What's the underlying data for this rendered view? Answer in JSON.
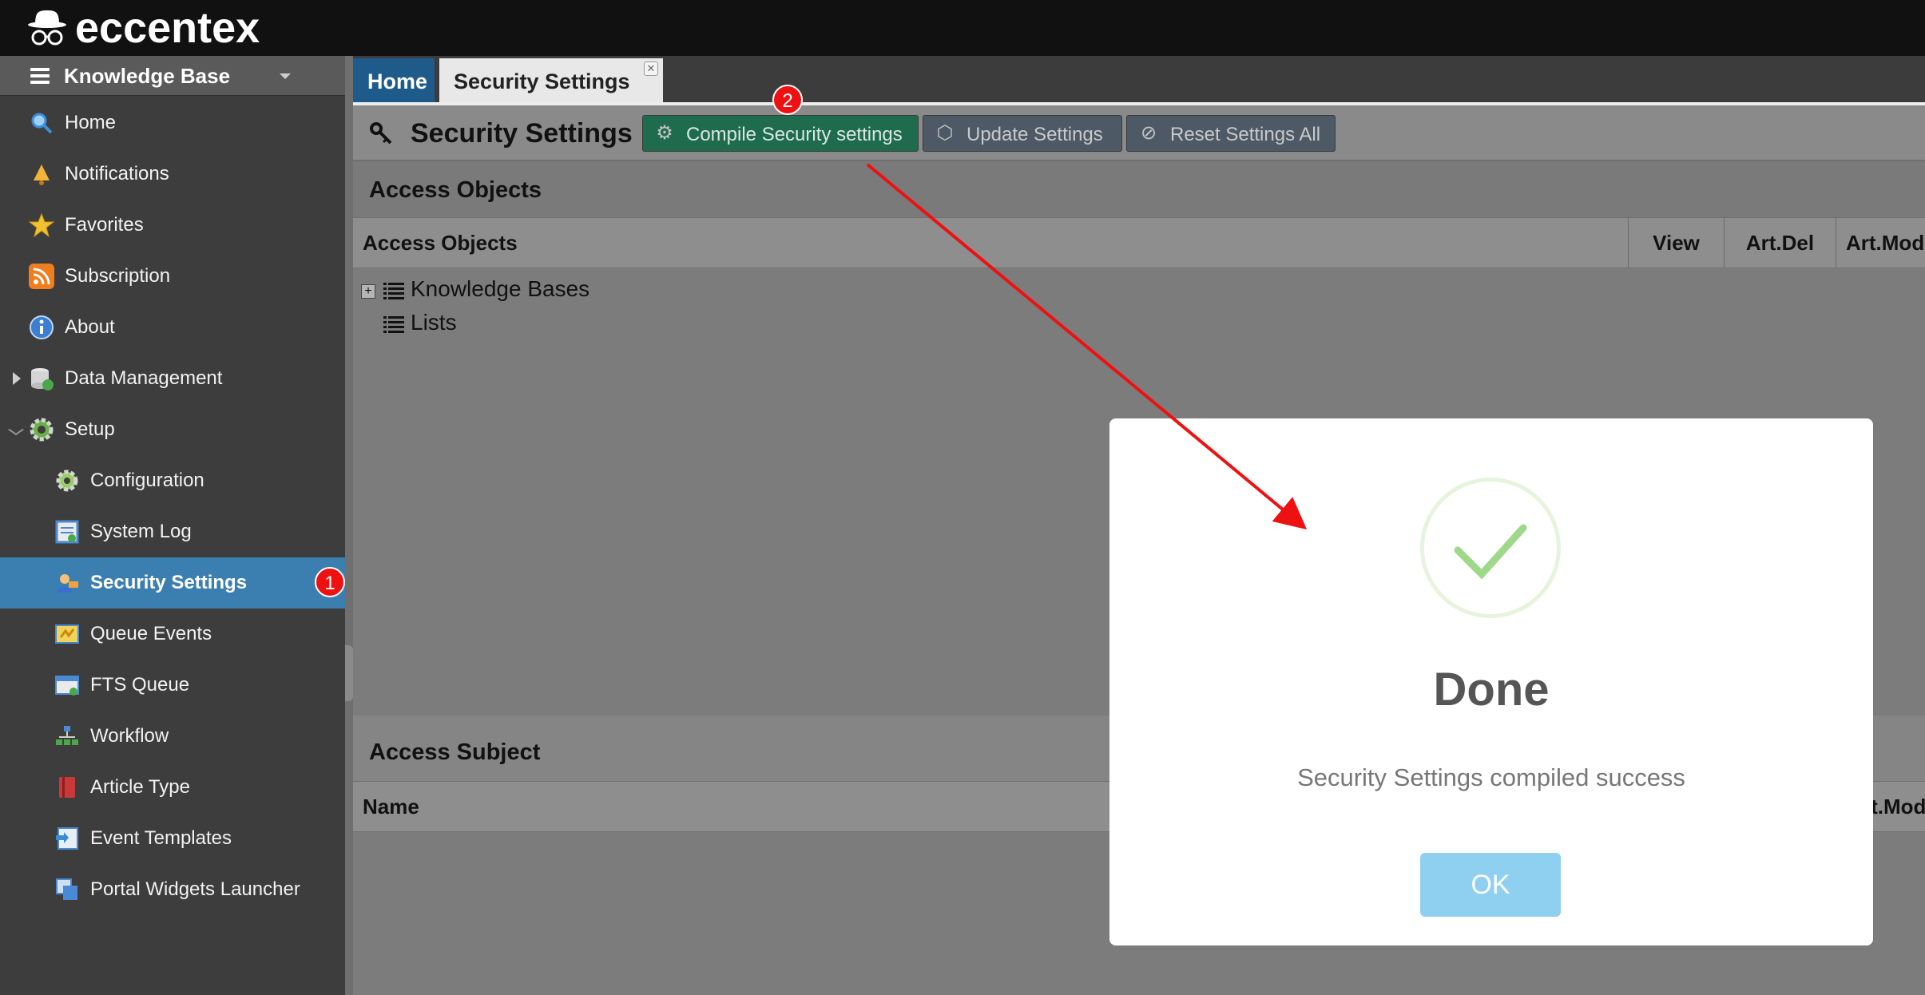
{
  "brand": {
    "name": "eccentex"
  },
  "sidebar": {
    "header": "Knowledge Base",
    "items": [
      {
        "label": "Home",
        "icon": "search-icon",
        "color": "#3c8fd9"
      },
      {
        "label": "Notifications",
        "icon": "bell-icon",
        "color": "#e0a030"
      },
      {
        "label": "Favorites",
        "icon": "star-icon",
        "color": "#f2c12e"
      },
      {
        "label": "Subscription",
        "icon": "rss-icon",
        "color": "#f07d1e"
      },
      {
        "label": "About",
        "icon": "info-icon",
        "color": "#3c7fd0"
      },
      {
        "label": "Data Management",
        "icon": "database-icon",
        "color": "#4aa84a"
      },
      {
        "label": "Setup",
        "icon": "gears-icon",
        "color": "#6bb04a"
      },
      {
        "label": "Configuration",
        "icon": "gear-icon",
        "color": "#6bb04a"
      },
      {
        "label": "System Log",
        "icon": "log-icon",
        "color": "#4a8ad4"
      },
      {
        "label": "Security Settings",
        "icon": "security-user-icon",
        "color": "#e8a038"
      },
      {
        "label": "Queue Events",
        "icon": "queue-icon",
        "color": "#e8c040"
      },
      {
        "label": "FTS Queue",
        "icon": "fts-icon",
        "color": "#4a8ad4"
      },
      {
        "label": "Workflow",
        "icon": "workflow-icon",
        "color": "#4aa84a"
      },
      {
        "label": "Article Type",
        "icon": "book-icon",
        "color": "#c83a3a"
      },
      {
        "label": "Event Templates",
        "icon": "template-icon",
        "color": "#4a8ad4"
      },
      {
        "label": "Portal Widgets Launcher",
        "icon": "widgets-icon",
        "color": "#4a8ad4"
      }
    ],
    "badge": "1"
  },
  "tabs": [
    {
      "label": "Home"
    },
    {
      "label": "Security Settings",
      "close": "✕"
    }
  ],
  "toolbar": {
    "title": "Security Settings",
    "badge": "2",
    "compile_label": "Compile Security settings",
    "update_label": "Update Settings",
    "reset_label": "Reset Settings All"
  },
  "access_objects": {
    "title": "Access Objects",
    "columns": [
      "Access Objects",
      "View",
      "Art.Del",
      "Art.Mod"
    ],
    "rows": [
      {
        "label": "Knowledge Bases",
        "expander": "+"
      },
      {
        "label": "Lists"
      }
    ]
  },
  "access_subject": {
    "title": "Access Subject",
    "columns": [
      "Name",
      "rt.Mod"
    ]
  },
  "dialog": {
    "title": "Done",
    "message": "Security Settings compiled success",
    "ok_label": "OK"
  },
  "colors": {
    "active_item": "#3a7fb0",
    "badge": "#ee1111",
    "compile_button": "#1f6b4e",
    "ok_button": "#8fd0f0",
    "check": "#9ed98a",
    "arrow": "#ee1111"
  }
}
